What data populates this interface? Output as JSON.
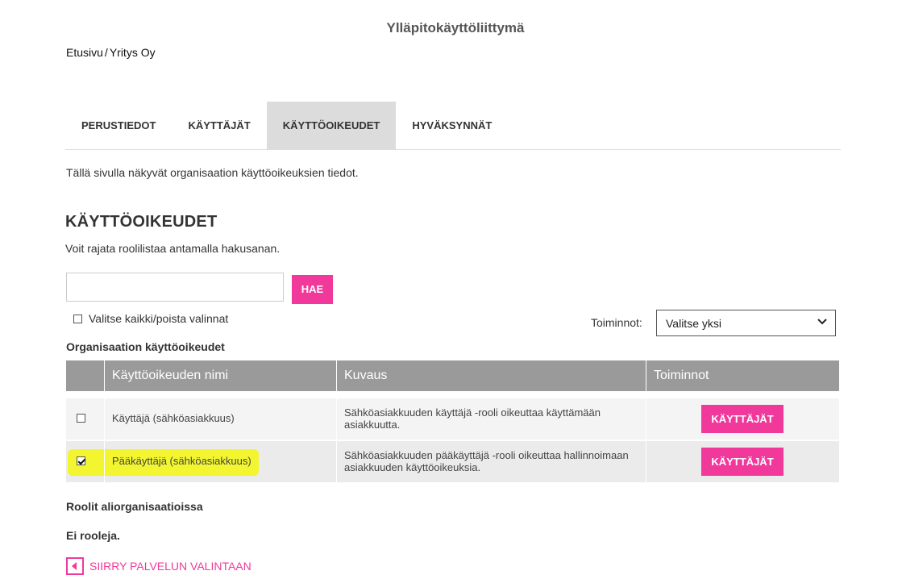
{
  "header": {
    "title": "Ylläpitokäyttöliittymä"
  },
  "breadcrumb": {
    "home": "Etusivu",
    "separator": "/",
    "current": "Yritys Oy"
  },
  "tabs": [
    {
      "label": "PERUSTIEDOT",
      "active": false
    },
    {
      "label": "KÄYTTÄJÄT",
      "active": false
    },
    {
      "label": "KÄYTTÖOIKEUDET",
      "active": true
    },
    {
      "label": "HYVÄKSYNNÄT",
      "active": false
    }
  ],
  "intro": "Tällä sivulla näkyvät organisaation käyttöoikeuksien tiedot.",
  "section": {
    "title": "KÄYTTÖOIKEUDET",
    "hint": "Voit rajata roolilistaa antamalla hakusanan."
  },
  "search": {
    "value": "",
    "placeholder": "",
    "button_label": "HAE"
  },
  "select_all": {
    "label": "Valitse kaikki/poista valinnat",
    "checked": false
  },
  "actions": {
    "label": "Toiminnot:",
    "selected": "Valitse yksi"
  },
  "table": {
    "title": "Organisaation käyttöoikeudet",
    "headers": [
      "",
      "Käyttöoikeuden nimi",
      "Kuvaus",
      "Toiminnot"
    ],
    "rows": [
      {
        "checked": false,
        "name": "Käyttäjä (sähköasiakkuus)",
        "description": "Sähköasiakkuuden käyttäjä -rooli oikeuttaa käyttämään asiakkuutta.",
        "action_label": "KÄYTTÄJÄT"
      },
      {
        "checked": true,
        "highlighted": true,
        "name": "Pääkäyttäjä (sähköasiakkuus)",
        "description": "Sähköasiakkuuden pääkäyttäjä -rooli oikeuttaa hallinnoimaan asiakkuuden käyttöoikeuksia.",
        "action_label": "KÄYTTÄJÄT"
      }
    ]
  },
  "sub_orgs": {
    "title": "Roolit aliorganisaatioissa",
    "empty_text": "Ei rooleja."
  },
  "back_link": {
    "label": "SIIRRY PALVELUN VALINTAAN",
    "icon": "back-arrow-icon"
  },
  "colors": {
    "accent": "#f0399b",
    "table_header": "#9a9a9a",
    "highlight": "#f2f530",
    "active_tab": "#dcdcdc"
  }
}
